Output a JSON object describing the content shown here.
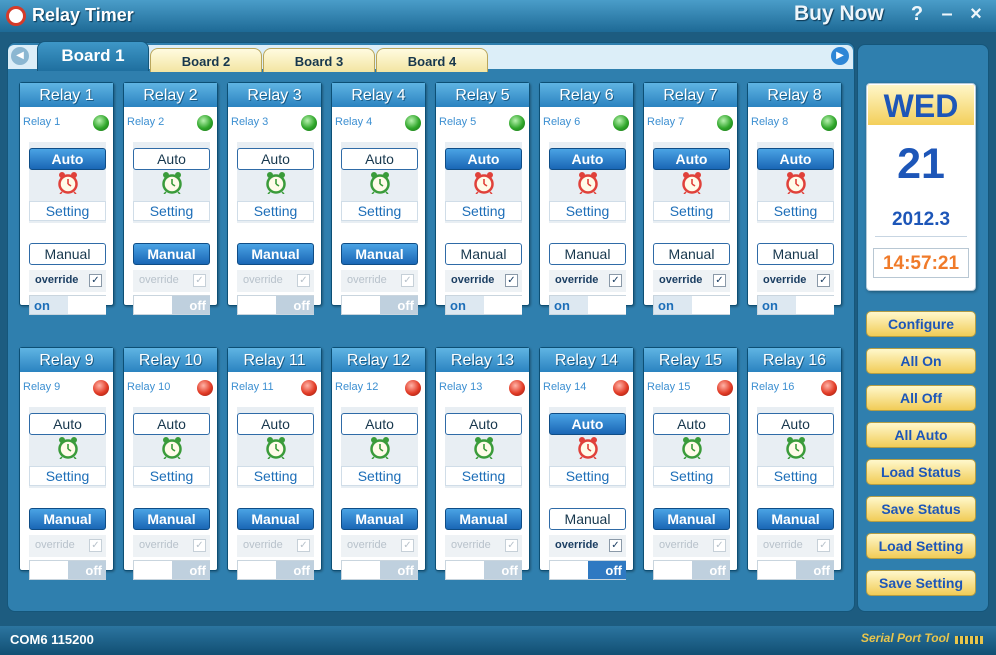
{
  "app": {
    "title": "Relay Timer",
    "buy_now": "Buy Now",
    "help": "?",
    "minimize": "–",
    "close": "×"
  },
  "tabs": [
    {
      "label": "Board 1",
      "active": true
    },
    {
      "label": "Board 2",
      "active": false
    },
    {
      "label": "Board 3",
      "active": false
    },
    {
      "label": "Board 4",
      "active": false
    }
  ],
  "relays": [
    {
      "title": "Relay 1",
      "name": "Relay 1",
      "led": "green",
      "auto_active": true,
      "manual_active": false,
      "override_enabled": true,
      "toggle": "on",
      "alarm_color": "red"
    },
    {
      "title": "Relay 2",
      "name": "Relay 2",
      "led": "green",
      "auto_active": false,
      "manual_active": true,
      "override_enabled": false,
      "toggle": "off",
      "alarm_color": "green"
    },
    {
      "title": "Relay 3",
      "name": "Relay 3",
      "led": "green",
      "auto_active": false,
      "manual_active": true,
      "override_enabled": false,
      "toggle": "off",
      "alarm_color": "green"
    },
    {
      "title": "Relay 4",
      "name": "Relay 4",
      "led": "green",
      "auto_active": false,
      "manual_active": true,
      "override_enabled": false,
      "toggle": "off",
      "alarm_color": "green"
    },
    {
      "title": "Relay 5",
      "name": "Relay 5",
      "led": "green",
      "auto_active": true,
      "manual_active": false,
      "override_enabled": true,
      "toggle": "on",
      "alarm_color": "red"
    },
    {
      "title": "Relay 6",
      "name": "Relay 6",
      "led": "green",
      "auto_active": true,
      "manual_active": false,
      "override_enabled": true,
      "toggle": "on",
      "alarm_color": "red"
    },
    {
      "title": "Relay 7",
      "name": "Relay 7",
      "led": "green",
      "auto_active": true,
      "manual_active": false,
      "override_enabled": true,
      "toggle": "on",
      "alarm_color": "red"
    },
    {
      "title": "Relay 8",
      "name": "Relay 8",
      "led": "green",
      "auto_active": true,
      "manual_active": false,
      "override_enabled": true,
      "toggle": "on",
      "alarm_color": "red"
    },
    {
      "title": "Relay 9",
      "name": "Relay 9",
      "led": "red",
      "auto_active": false,
      "manual_active": true,
      "override_enabled": false,
      "toggle": "off",
      "alarm_color": "green"
    },
    {
      "title": "Relay 10",
      "name": "Relay 10",
      "led": "red",
      "auto_active": false,
      "manual_active": true,
      "override_enabled": false,
      "toggle": "off",
      "alarm_color": "green"
    },
    {
      "title": "Relay 11",
      "name": "Relay 11",
      "led": "red",
      "auto_active": false,
      "manual_active": true,
      "override_enabled": false,
      "toggle": "off",
      "alarm_color": "green"
    },
    {
      "title": "Relay 12",
      "name": "Relay 12",
      "led": "red",
      "auto_active": false,
      "manual_active": true,
      "override_enabled": false,
      "toggle": "off",
      "alarm_color": "green"
    },
    {
      "title": "Relay 13",
      "name": "Relay 13",
      "led": "red",
      "auto_active": false,
      "manual_active": true,
      "override_enabled": false,
      "toggle": "off",
      "alarm_color": "green"
    },
    {
      "title": "Relay 14",
      "name": "Relay 14",
      "led": "red",
      "auto_active": true,
      "manual_active": false,
      "override_enabled": true,
      "toggle": "off",
      "alarm_color": "red"
    },
    {
      "title": "Relay 15",
      "name": "Relay 15",
      "led": "red",
      "auto_active": false,
      "manual_active": true,
      "override_enabled": false,
      "toggle": "off",
      "alarm_color": "green"
    },
    {
      "title": "Relay 16",
      "name": "Relay 16",
      "led": "red",
      "auto_active": false,
      "manual_active": true,
      "override_enabled": false,
      "toggle": "off",
      "alarm_color": "green"
    }
  ],
  "labels": {
    "auto": "Auto",
    "setting": "Setting",
    "manual": "Manual",
    "override": "override",
    "on": "on",
    "off": "off"
  },
  "date": {
    "day": "WED",
    "date": "21",
    "year_month": "2012.3",
    "time": "14:57:21"
  },
  "side_buttons": [
    "Configure",
    "All On",
    "All Off",
    "All Auto",
    "Load Status",
    "Save Status",
    "Load Setting",
    "Save Setting"
  ],
  "status": {
    "port": "COM6 115200",
    "brand": "Serial Port Tool"
  },
  "colors": {
    "accent_blue": "#2b83c0",
    "led_green": "#2fa62a",
    "led_red": "#e23b26",
    "time_orange": "#f07b2a",
    "date_blue": "#1d56b8"
  },
  "icons": {
    "app": "alarm-clock-icon",
    "tab_prev": "left-arrow-icon",
    "tab_next": "right-arrow-icon",
    "timer": "alarm-clock-icon"
  }
}
